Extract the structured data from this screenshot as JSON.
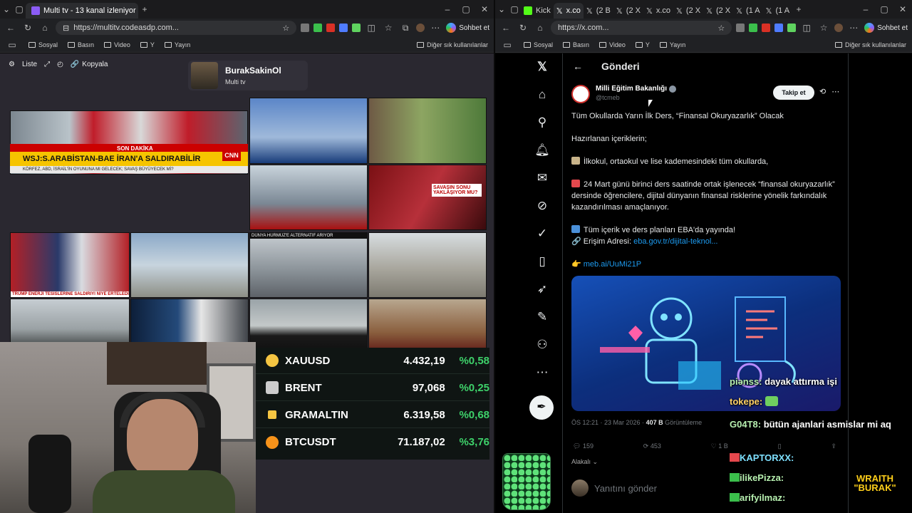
{
  "left_browser": {
    "tabs": [
      {
        "label": "Multi tv - 13 kanal izleniyor",
        "active": true
      }
    ],
    "url": "https://multitv.codeasdp.com...",
    "copilot_label": "Sohbet et",
    "bookmarks": [
      "Sosyal",
      "Basın",
      "Video",
      "Y",
      "Yayın"
    ],
    "bookmarks_other": "Diğer sık kullanılanlar"
  },
  "right_browser": {
    "tabs": [
      "Kick",
      "x.co",
      "(2 B",
      "(2 X",
      "x.co",
      "(2 X",
      "(2 X",
      "(1 A",
      "(1 A"
    ],
    "url": "https://x.com...",
    "copilot_label": "Sohbet et",
    "bookmarks": [
      "Sosyal",
      "Basın",
      "Video",
      "Y",
      "Yayın"
    ],
    "bookmarks_other": "Diğer sık kullanılanlar"
  },
  "multitv": {
    "toolbar": {
      "list_label": "Liste",
      "copy_label": "Kopyala"
    },
    "channel": {
      "name": "BurakSakinOl",
      "sub": "Multi tv"
    },
    "breaking_banner": "WSJ:S.ARABİSTAN-BAE İRAN'A SALDIRABİLİR",
    "breaking_tag": "SON DAKİKA",
    "breaking_sub": "KÖRFEZ, ABD, İSRAİL'İN OYUNUNA MI GELECEK; SAVAŞ BÜYÜYECEK Mİ?",
    "cnn_tag": "CNN",
    "cell_captions": [
      "SAVAŞIN SONU YAKLAŞIYOR MU?",
      "DÜNYA HÜRMÜZ'E ALTERNATİF ARIYOR",
      "TRUMP ENERJİ TESİSLERİNE SALDIRIYI NİYE ERTELEDİ?"
    ]
  },
  "ticker": [
    {
      "symbol": "XAUUSD",
      "value": "4.432,19",
      "change": "%0,58",
      "icon_color": "#f5c542"
    },
    {
      "symbol": "BRENT",
      "value": "97,068",
      "change": "%0,25",
      "icon_color": "#cccccc"
    },
    {
      "symbol": "GRAMALTIN",
      "value": "6.319,58",
      "change": "%0,68",
      "icon_color": "#f5c542"
    },
    {
      "symbol": "BTCUSDT",
      "value": "71.187,02",
      "change": "%3,76",
      "icon_color": "#f7931a"
    }
  ],
  "x": {
    "header_title": "Gönderi",
    "account": {
      "name": "Milli Eğitim Bakanlığı",
      "handle": "@tcmeb"
    },
    "follow_label": "Takip et",
    "lines": {
      "l1": "Tüm Okullarda Yarın İlk Ders, “Finansal Okuryazarlık” Olacak",
      "l2": "Hazırlanan içeriklerin;",
      "l3": "İlkokul, ortaokul ve lise kademesindeki tüm okullarda,",
      "l4": "24 Mart günü birinci ders saatinde ortak işlenecek “finansal okuryazarlık” dersinde öğrencilere, dijital dünyanın finansal risklerine yönelik farkındalık kazandırılması amaçlanıyor.",
      "l5": "Tüm içerik ve ders planları EBA'da yayında!",
      "l6_prefix": "Erişim Adresi:",
      "l6_link": "eba.gov.tr/dijital-teknol...",
      "l7_link": "meb.ai/UuMi21P"
    },
    "meta": {
      "time": "ÖS 12:21 · 23 Mar 2026 · ",
      "views": "407 B",
      "views_label": " Görüntüleme"
    },
    "actions": {
      "replies": "159",
      "reposts": "453",
      "likes": "1 B"
    },
    "sort_label": "Alakalı",
    "reply_placeholder": "Yanıtını gönder"
  },
  "chat": [
    {
      "user": "piənss:",
      "msg": "dayak attırma işi"
    },
    {
      "user": "tokepe:",
      "msg": ""
    },
    {
      "user": "G04T8:",
      "msg": "bütün ajanlari asmislar mi aq"
    },
    {
      "user": "KAPTORXX:",
      "msg": ""
    },
    {
      "user": "ilikePizza:",
      "msg": ""
    },
    {
      "user": "arifyilmaz:",
      "msg": ""
    }
  ],
  "overlay": {
    "line1": "WRAITH",
    "line2": "\"BURAK\""
  }
}
